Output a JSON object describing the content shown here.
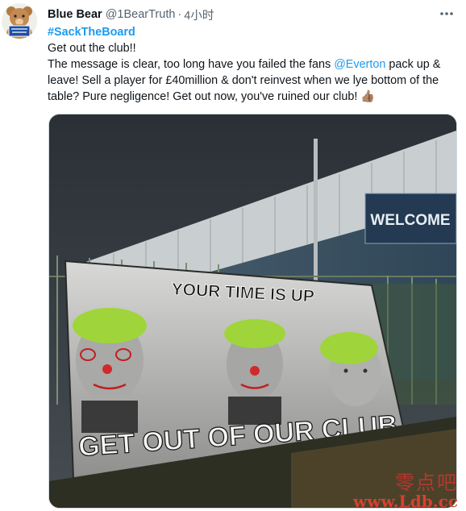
{
  "tweet": {
    "display_name": "Blue Bear",
    "handle": "@1BearTruth",
    "separator": "·",
    "time": "4小时",
    "hashtag": "#SackTheBoard",
    "line1": "Get out the club!!",
    "line2_pre": "The message is clear, too long have you failed the fans ",
    "mention": "@Everton",
    "line2_post": " pack up & leave! Sell a player for £40million & don't reinvest when we lye bottom of the table? Pure negligence! Get out now, you've ruined our club! ",
    "emoji": "👍🏽"
  },
  "media": {
    "sign_text": "WELCOME",
    "banner_top": "YOUR TIME IS UP",
    "banner_bottom": "GET OUT OF OUR CLUB"
  },
  "watermark": {
    "chinese": "零点吧",
    "url": "www.Ldb.cc"
  },
  "colors": {
    "link": "#1d9bf0",
    "text": "#0f1419",
    "muted": "#536471"
  }
}
